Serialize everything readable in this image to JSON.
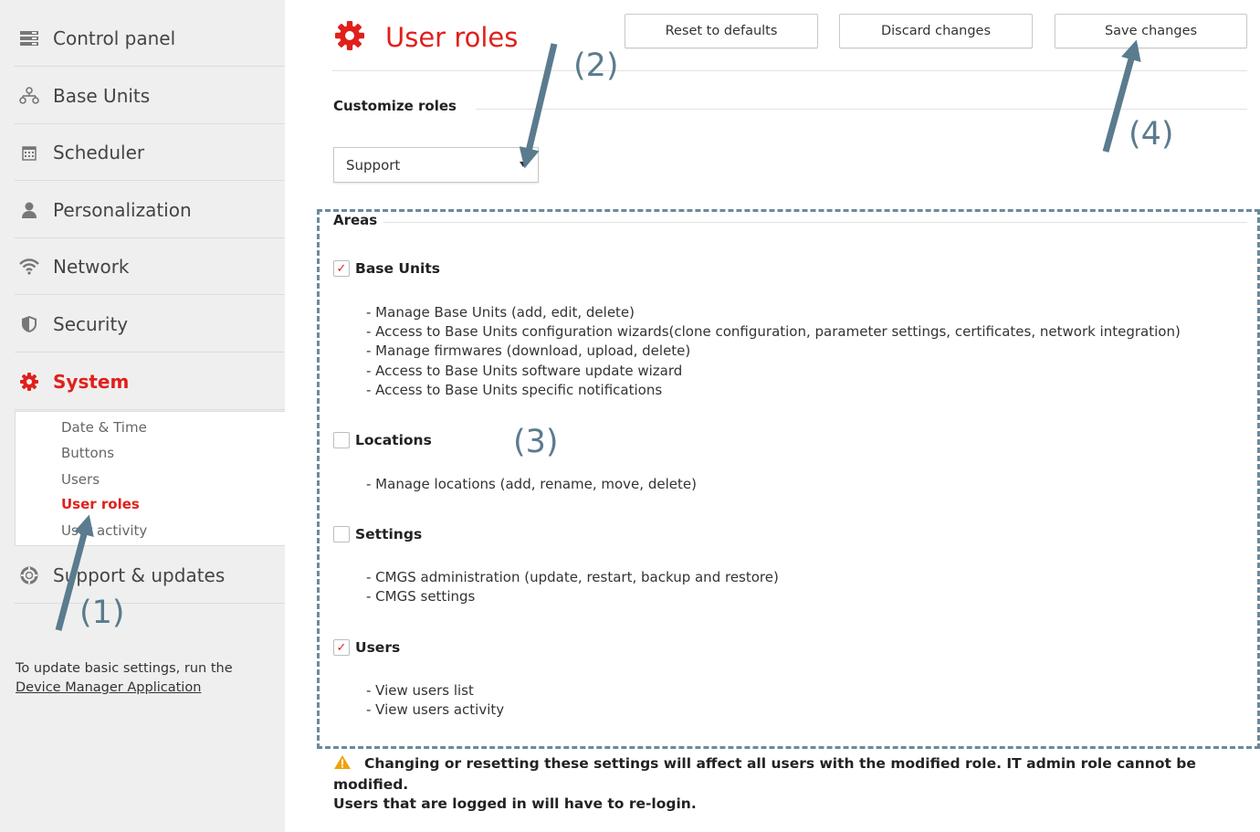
{
  "sidebar": {
    "items": [
      {
        "label": "Control panel",
        "icon": "server-icon"
      },
      {
        "label": "Base Units",
        "icon": "network-nodes-icon"
      },
      {
        "label": "Scheduler",
        "icon": "calendar-icon"
      },
      {
        "label": "Personalization",
        "icon": "user-icon"
      },
      {
        "label": "Network",
        "icon": "wifi-icon"
      },
      {
        "label": "Security",
        "icon": "shield-icon"
      },
      {
        "label": "System",
        "icon": "gear-icon"
      }
    ],
    "sub_items": [
      "Date & Time",
      "Buttons",
      "Users",
      "User roles",
      "User activity"
    ],
    "support_item": {
      "label": "Support & updates",
      "icon": "lifebuoy-icon"
    },
    "note_text": "To update basic settings, run the",
    "note_link": "Device Manager Application"
  },
  "header": {
    "title": "User roles",
    "buttons": {
      "reset": "Reset to defaults",
      "discard": "Discard changes",
      "save": "Save changes"
    }
  },
  "customize": {
    "title": "Customize roles",
    "selected_role": "Support"
  },
  "areas": {
    "title": "Areas",
    "groups": [
      {
        "label": "Base Units",
        "checked": true,
        "items": [
          "- Manage Base Units (add, edit, delete)",
          "- Access to Base Units configuration wizards(clone configuration, parameter settings, certificates, network integration)",
          "- Manage firmwares (download, upload, delete)",
          "- Access to Base Units software update wizard",
          "- Access to Base Units specific notifications"
        ]
      },
      {
        "label": "Locations",
        "checked": false,
        "items": [
          "- Manage locations (add, rename, move, delete)"
        ]
      },
      {
        "label": "Settings",
        "checked": false,
        "items": [
          "- CMGS administration (update, restart, backup and restore)",
          "- CMGS settings"
        ]
      },
      {
        "label": "Users",
        "checked": true,
        "items": [
          "- View users list",
          "- View users activity"
        ]
      }
    ]
  },
  "warning": {
    "line1": "Changing or resetting these settings will affect all users with the modified role. IT admin role cannot be modified.",
    "line2": "Users that are logged in will have to re-login."
  },
  "annotations": [
    "(1)",
    "(2)",
    "(3)",
    "(4)"
  ],
  "colors": {
    "accent": "#e0201b",
    "annotation": "#5b7b8e",
    "warning": "#f0a30a"
  }
}
